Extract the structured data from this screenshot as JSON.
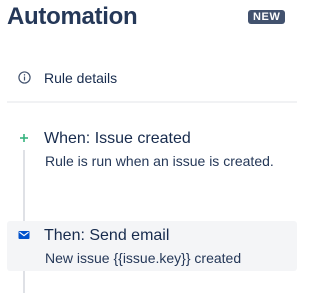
{
  "header": {
    "title": "Automation",
    "badge": "NEW"
  },
  "details": {
    "icon": "info-icon",
    "label": "Rule details"
  },
  "steps": [
    {
      "icon": "plus-icon",
      "icon_color": "#36b37e",
      "title": "When: Issue created",
      "subtitle": "Rule is run when an issue is created."
    },
    {
      "icon": "mail-icon",
      "icon_color": "#0052cc",
      "title": "Then: Send email",
      "subtitle": "New issue {{issue.key}} created"
    }
  ],
  "colors": {
    "badge_bg": "#42526e",
    "selected_step_bg": "#f4f5f7"
  }
}
